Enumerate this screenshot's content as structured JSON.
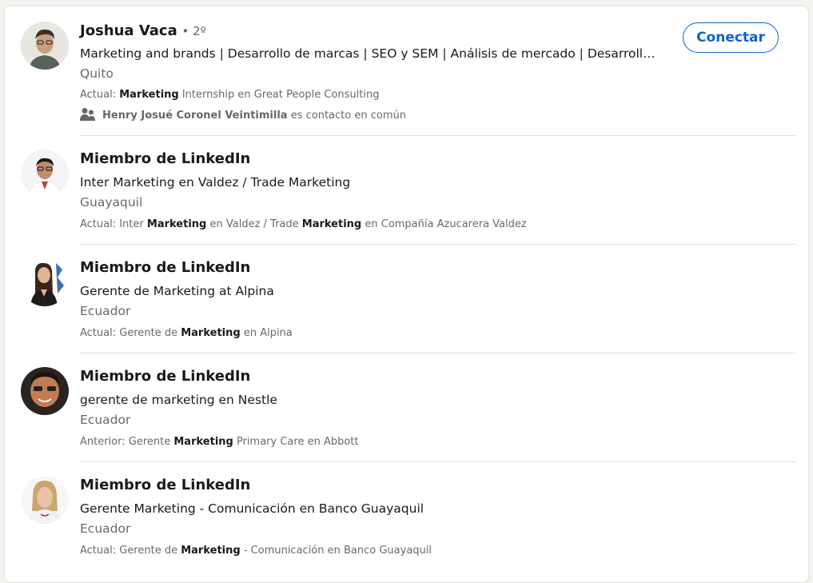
{
  "results": [
    {
      "name": "Joshua Vaca",
      "degree": "• 2º",
      "headline": "Marketing and brands | Desarrollo de marcas | SEO y SEM | Análisis de mercado | Desarrollo...",
      "location": "Quito",
      "summary": {
        "prefix": "Actual: ",
        "highlight1": "Marketing",
        "middle": " Internship en Great People Consulting",
        "highlight2": "",
        "suffix": ""
      },
      "mutual": {
        "name": "Henry Josué Coronel Veintimilla",
        "text": " es contacto en común"
      },
      "connect_label": "Conectar",
      "avatar_icon": "person-photo-icon"
    },
    {
      "name": "Miembro de LinkedIn",
      "headline": "Inter Marketing en Valdez / Trade Marketing",
      "location": "Guayaquil",
      "summary": {
        "prefix": "Actual: Inter ",
        "highlight1": "Marketing",
        "middle": " en Valdez / Trade ",
        "highlight2": "Marketing",
        "suffix": " en Compañía Azucarera Valdez"
      },
      "avatar_icon": "person-photo-icon"
    },
    {
      "name": "Miembro de LinkedIn",
      "headline": "Gerente de Marketing at Alpina",
      "location": "Ecuador",
      "summary": {
        "prefix": "Actual: Gerente de ",
        "highlight1": "Marketing",
        "middle": " en Alpina",
        "highlight2": "",
        "suffix": ""
      },
      "avatar_icon": "person-photo-icon"
    },
    {
      "name": "Miembro de LinkedIn",
      "headline": "gerente de marketing en Nestle",
      "location": "Ecuador",
      "summary": {
        "prefix": "Anterior: Gerente ",
        "highlight1": "Marketing",
        "middle": " Primary Care en Abbott",
        "highlight2": "",
        "suffix": ""
      },
      "avatar_icon": "person-photo-icon"
    },
    {
      "name": "Miembro de LinkedIn",
      "headline": "Gerente Marketing - Comunicación en Banco Guayaquil",
      "location": "Ecuador",
      "summary": {
        "prefix": "Actual: Gerente de ",
        "highlight1": "Marketing",
        "middle": " - Comunicación en Banco Guayaquil",
        "highlight2": "",
        "suffix": ""
      },
      "avatar_icon": "person-photo-icon"
    }
  ],
  "colors": {
    "accent": "#0a66c2",
    "background": "#f3f2ef",
    "card": "#ffffff",
    "divider": "#e0dfdc"
  }
}
